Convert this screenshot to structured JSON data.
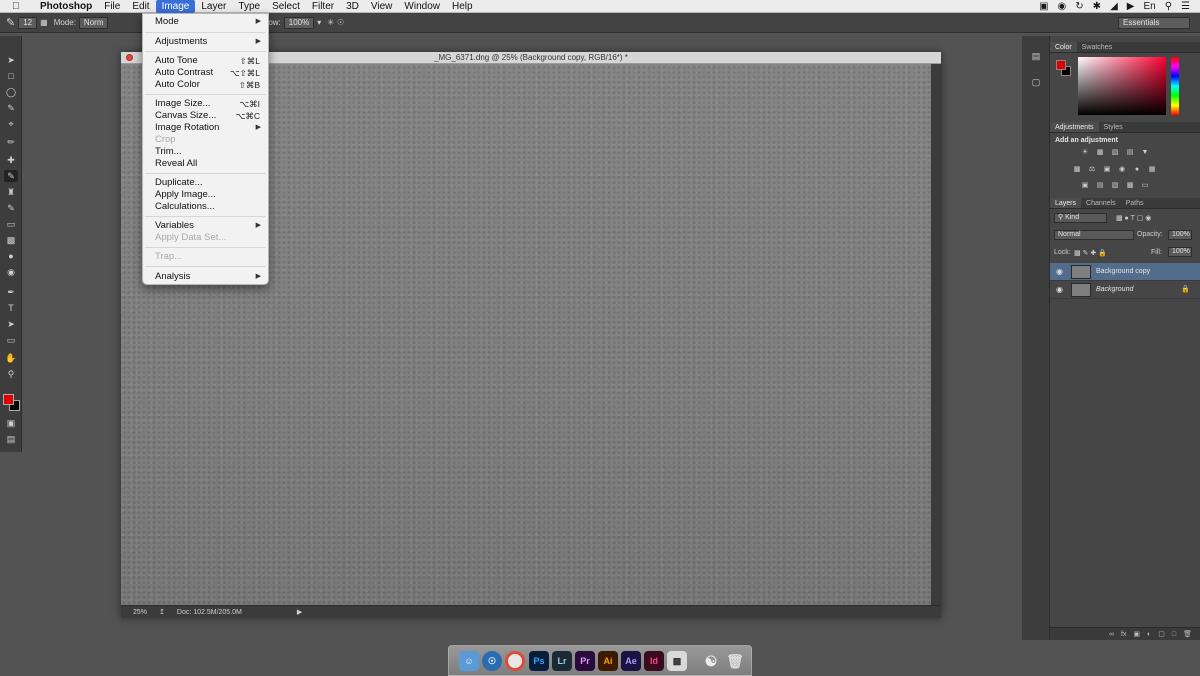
{
  "menubar": {
    "app_name": "Photoshop",
    "items": [
      "File",
      "Edit",
      "Image",
      "Layer",
      "Type",
      "Select",
      "Filter",
      "3D",
      "View",
      "Window",
      "Help"
    ],
    "active_item": "Image",
    "input_lang": "En"
  },
  "options_bar": {
    "brush_size": "12",
    "mode_label": "Mode:",
    "mode_value": "Norm",
    "flow_label": "Flow:",
    "flow_value": "100%",
    "workspace": "Essentials"
  },
  "image_menu": {
    "mode": "Mode",
    "adjustments": "Adjustments",
    "auto_tone": "Auto Tone",
    "auto_tone_sc": "⇧⌘L",
    "auto_contrast": "Auto Contrast",
    "auto_contrast_sc": "⌥⇧⌘L",
    "auto_color": "Auto Color",
    "auto_color_sc": "⇧⌘B",
    "image_size": "Image Size...",
    "image_size_sc": "⌥⌘I",
    "canvas_size": "Canvas Size...",
    "canvas_size_sc": "⌥⌘C",
    "image_rotation": "Image Rotation",
    "crop": "Crop",
    "trim": "Trim...",
    "reveal_all": "Reveal All",
    "duplicate": "Duplicate...",
    "apply_image": "Apply Image...",
    "calculations": "Calculations...",
    "variables": "Variables",
    "apply_data_set": "Apply Data Set...",
    "trap": "Trap...",
    "analysis": "Analysis"
  },
  "document": {
    "title": "_MG_6371.dng @ 25% (Background copy, RGB/16*) *",
    "zoom": "25%",
    "doc_size": "Doc: 102.5M/205.0M"
  },
  "panels": {
    "color_tab": "Color",
    "swatches_tab": "Swatches",
    "adjustments_tab": "Adjustments",
    "styles_tab": "Styles",
    "add_adjustment": "Add an adjustment",
    "layers_tab": "Layers",
    "channels_tab": "Channels",
    "paths_tab": "Paths",
    "kind_filter": "Kind",
    "blend_mode": "Normal",
    "opacity_label": "Opacity:",
    "opacity_value": "100%",
    "lock_label": "Lock:",
    "fill_label": "Fill:",
    "fill_value": "100%",
    "layers": [
      {
        "name": "Background copy",
        "selected": true
      },
      {
        "name": "Background",
        "selected": false
      }
    ]
  },
  "colors": {
    "foreground": "#e00000",
    "background": "#000000",
    "menu_highlight": "#3a6fd8",
    "selected_layer": "#536c8c"
  },
  "dock": {
    "apps": [
      "Finder",
      "Safari",
      "Chrome",
      "Ps",
      "Lr",
      "Pr",
      "Ai",
      "Ae",
      "Id",
      "Preview",
      "Automator",
      "Trash"
    ]
  }
}
